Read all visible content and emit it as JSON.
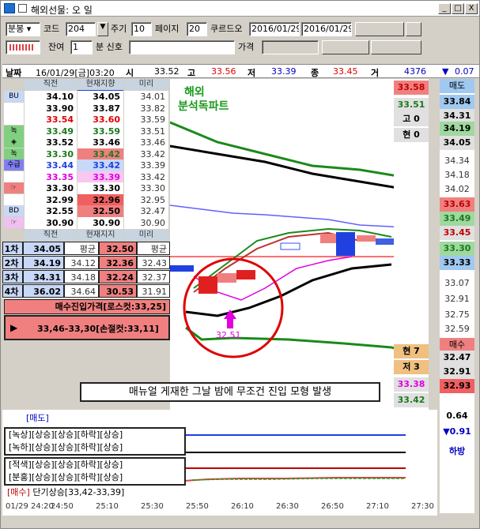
{
  "window": {
    "title": "해외선물: 오 일",
    "min": "_",
    "max": "□",
    "close": "X"
  },
  "toolbar": {
    "mode": "분봉",
    "code_label": "코드",
    "code": "204",
    "period_label": "주기",
    "period": "10",
    "page_label": "페이지",
    "page": "20",
    "courtesy": "쿠르드오",
    "date_from": "2016/01/29",
    "date_to": "2016/01/29",
    "remain_label": "잔여",
    "remain": "1",
    "signal_label": "분 신호",
    "price_label": "가격"
  },
  "header": {
    "date_label": "날짜",
    "datetime": "16/01/29[금]03:20",
    "open_label": "시",
    "open": "33.52",
    "high_label": "고",
    "high": "33.56",
    "low_label": "저",
    "low": "33.39",
    "close_label": "종",
    "close": "33.45",
    "vol_label": "거",
    "volume": "4376",
    "change": "0.07"
  },
  "orderbook": {
    "columns": [
      "직전",
      "현재지향",
      "미리"
    ],
    "footer_columns": [
      "직전",
      "현재지지",
      "미리"
    ],
    "rows": [
      {
        "tag": "BU",
        "a": "34.10",
        "b": "34.05",
        "c": "34.01"
      },
      {
        "tag": "",
        "a": "33.90",
        "b": "33.87",
        "c": "33.82"
      },
      {
        "tag": "",
        "a": "33.54",
        "b": "33.60",
        "c": "33.59"
      },
      {
        "tag": "녹",
        "a": "33.49",
        "b": "33.59",
        "c": "33.51"
      },
      {
        "tag": "◈",
        "a": "33.52",
        "b": "33.46",
        "c": "33.46"
      },
      {
        "tag": "녹",
        "a": "33.30",
        "b": "33.42",
        "c": "33.42"
      },
      {
        "tag": "수급",
        "a": "33.44",
        "b": "33.42",
        "c": "33.39"
      },
      {
        "tag": "",
        "a": "33.35",
        "b": "33.39",
        "c": "33.42"
      },
      {
        "tag": "☞",
        "a": "33.30",
        "b": "33.30",
        "c": "33.30"
      },
      {
        "tag": "",
        "a": "32.99",
        "b": "32.96",
        "c": "32.95"
      },
      {
        "tag": "BD",
        "a": "32.55",
        "b": "32.50",
        "c": "32.47"
      },
      {
        "tag": "☞",
        "a": "30.90",
        "b": "30.90",
        "c": "30.90"
      }
    ]
  },
  "levels": {
    "rows": [
      {
        "label": "1차",
        "a": "34.05",
        "avg1": "평균",
        "b": "32.50",
        "avg2": "평균"
      },
      {
        "label": "2차",
        "a": "34.19",
        "avg1": "34.12",
        "b": "32.36",
        "avg2": "32.43"
      },
      {
        "label": "3차",
        "a": "34.31",
        "avg1": "34.18",
        "b": "32.24",
        "avg2": "32.37"
      },
      {
        "label": "4차",
        "a": "36.02",
        "avg1": "34.64",
        "b": "30.53",
        "avg2": "31.91"
      }
    ]
  },
  "entry": {
    "buy_entry": "매수진입가격[로스컷:33,25]",
    "range": "33,46-33,30[손절컷:33,11]",
    "arrow": "▶"
  },
  "chart": {
    "watermark1": "해외",
    "watermark2": "분석독파트",
    "low_marker": "32.51",
    "annotation": "매뉴얼 게재한 그날 밤에 무조건 진입 모형 발생",
    "sell_label": "[매도]",
    "buy_label": "[매수]",
    "buy_signal": "단기상승[33,42-33,39]"
  },
  "chart_data": {
    "type": "line",
    "x": [
      "01/29 24:20",
      "24:50",
      "25:10",
      "25:30",
      "25:50",
      "26:10",
      "26:30",
      "26:50",
      "27:10",
      "27:30"
    ],
    "y_ticks": [
      "33.84",
      "34.31",
      "34.19",
      "34.05",
      "34.34",
      "34.18",
      "34.02",
      "33.63",
      "33.49",
      "33.45",
      "33.30",
      "33.33",
      "33.07",
      "32.91",
      "32.75",
      "32.59",
      "32.47",
      "32.91",
      "32.93"
    ]
  },
  "right_panel": {
    "sell_title": "매도",
    "buy_title": "매수",
    "top_val": "33.58",
    "second": "33.51",
    "high_lbl": "고",
    "high_val": "0",
    "cur_lbl": "현",
    "cur_val": "0",
    "cur2_lbl": "현",
    "cur2_val": "7",
    "low2_lbl": "저",
    "low2_val": "3",
    "p1": "33.38",
    "p2": "33.42",
    "ind1": "0.64",
    "ind2": "▼0.91",
    "ind3": "하방"
  },
  "right_scale": [
    "33.84",
    "34.31",
    "34.19",
    "34.05",
    "34.34",
    "34.18",
    "34.02",
    "33.63",
    "33.49",
    "33.45",
    "33.30",
    "33.33",
    "33.07",
    "32.91",
    "32.75",
    "32.59",
    "32.47",
    "32.91",
    "32.93"
  ],
  "indicators": {
    "box1": [
      "[녹상][상승][상승][하락][상승]",
      "[녹하][상승][상승][하락][상승]"
    ],
    "box2": [
      "[적색][상승][상승][하락][상승]",
      "[분홍][상승][상승][하락][상승]"
    ]
  }
}
